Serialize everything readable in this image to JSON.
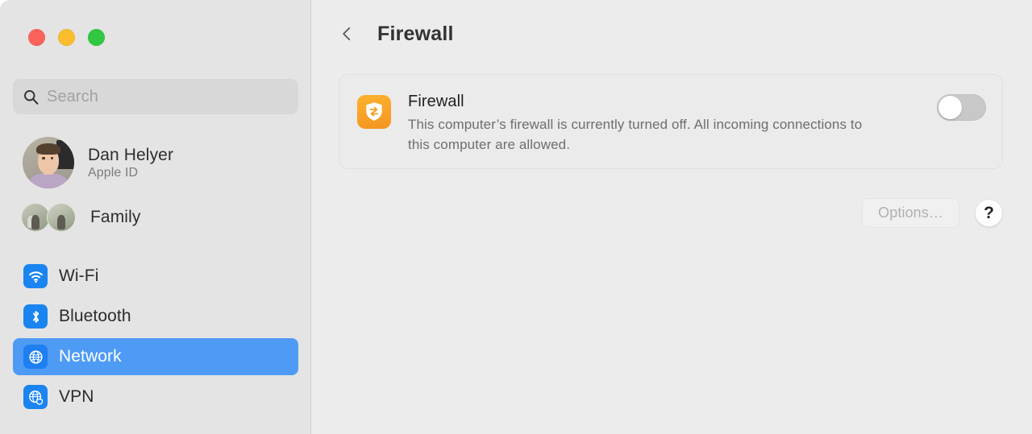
{
  "window": {
    "traffic_lights": [
      {
        "name": "close",
        "color": "#f9635a"
      },
      {
        "name": "minimize",
        "color": "#f9bd2e"
      },
      {
        "name": "zoom",
        "color": "#2fc840"
      }
    ]
  },
  "sidebar": {
    "search": {
      "placeholder": "Search",
      "value": "",
      "icon": "search-icon"
    },
    "profile": {
      "name": "Dan Helyer",
      "subtitle": "Apple ID"
    },
    "family": {
      "label": "Family"
    },
    "items": [
      {
        "label": "Wi-Fi",
        "icon": "wifi-icon",
        "selected": false
      },
      {
        "label": "Bluetooth",
        "icon": "bluetooth-icon",
        "selected": false
      },
      {
        "label": "Network",
        "icon": "globe-icon",
        "selected": true
      },
      {
        "label": "VPN",
        "icon": "globe-shield-icon",
        "selected": false
      }
    ],
    "selected_color": "#4e9bf5"
  },
  "main": {
    "back_icon": "chevron-left-icon",
    "title": "Firewall",
    "card": {
      "icon": "firewall-shield-icon",
      "icon_color": "#f7a326",
      "title": "Firewall",
      "description": "This computer’s firewall is currently turned off. All incoming connections to this computer are allowed.",
      "toggle": {
        "name": "firewall-toggle",
        "state": "off"
      }
    },
    "buttons": {
      "options_label": "Options…",
      "options_enabled": false,
      "help_label": "?"
    }
  }
}
